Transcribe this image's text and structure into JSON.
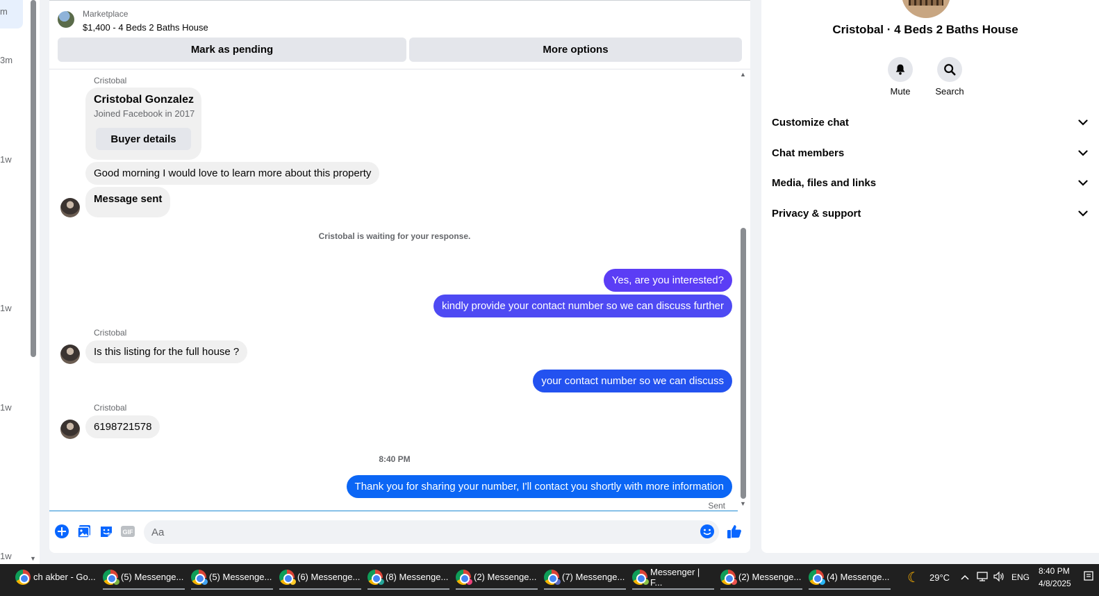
{
  "left_strip": {
    "times": [
      "m",
      "3m",
      "1w",
      "1w",
      "1w",
      "1w"
    ]
  },
  "marketplace": {
    "kicker": "Marketplace",
    "title": "$1,400 - 4 Beds 2 Baths House",
    "mark_pending_label": "Mark as pending",
    "more_options_label": "More options"
  },
  "thread": {
    "profile_sender": "Cristobal",
    "profile_name": "Cristobal Gonzalez",
    "profile_joined": "Joined Facebook in 2017",
    "buyer_details_label": "Buyer details",
    "msg_intro": "Good morning I would love to learn more about this property",
    "msg_sent_notice": "Message sent",
    "waiting_notice": "Cristobal is waiting for your response.",
    "out_1": "Yes, are you interested?",
    "out_2": "kindly provide your contact number so we can discuss further",
    "sender_2": "Cristobal",
    "in_2": "Is this listing for the full house ?",
    "out_3": "your contact number so we can discuss",
    "sender_3": "Cristobal",
    "in_3": "6198721578",
    "timestamp": "8:40 PM",
    "out_4": "Thank you for sharing your number, I'll contact you shortly with more information",
    "sent_label": "Sent"
  },
  "composer": {
    "placeholder": "Aa",
    "gif_label": "GIF"
  },
  "info_panel": {
    "title": "Cristobal · 4 Beds 2 Baths House",
    "mute_label": "Mute",
    "search_label": "Search",
    "sections": [
      "Customize chat",
      "Chat members",
      "Media, files and links",
      "Privacy & support"
    ]
  },
  "taskbar": {
    "tasks": [
      "ch akber - Go...",
      "(5) Messenge...",
      "(5) Messenge...",
      "(6) Messenge...",
      "(8) Messenge...",
      "(2) Messenge...",
      "(7) Messenge...",
      "Messenger | F...",
      "(2) Messenge...",
      "(4) Messenge..."
    ],
    "weather": "29°C",
    "language": "ENG",
    "time": "8:40 PM",
    "date": "4/8/2025"
  },
  "colors": {
    "messenger_blue": "#0866ff",
    "out_bubble_purple": "#5b3df5",
    "out_bubble_blue": "#0b66f5",
    "out_bubble_blue_deep": "#1a5ff0"
  }
}
